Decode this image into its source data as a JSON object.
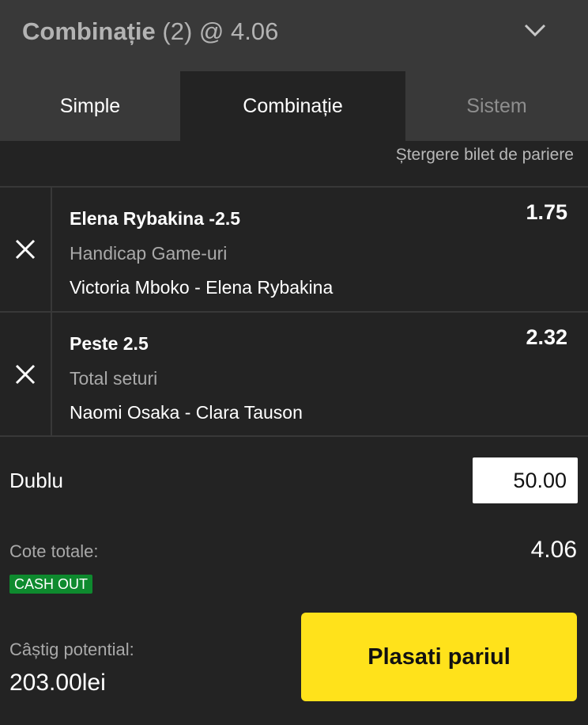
{
  "header": {
    "title_bold": "Combinație",
    "title_rest": " (2) @ 4.06"
  },
  "tabs": [
    {
      "label": "Simple",
      "active": false
    },
    {
      "label": "Combinație",
      "active": true
    },
    {
      "label": "Sistem",
      "active": false
    }
  ],
  "clear_label": "Ștergere bilet de pariere",
  "selections": [
    {
      "name": "Elena Rybakina -2.5",
      "market": "Handicap Game-uri",
      "event": "Victoria Mboko - Elena Rybakina",
      "odds": "1.75"
    },
    {
      "name": "Peste 2.5",
      "market": "Total seturi",
      "event": "Naomi Osaka - Clara Tauson",
      "odds": "2.32"
    }
  ],
  "bet": {
    "type_label": "Dublu",
    "stake": "50.00"
  },
  "summary": {
    "total_odds_label": "Cote totale:",
    "total_odds": "4.06",
    "cashout_badge": "CASH OUT",
    "potential_win_label": "Câștig potential:",
    "potential_win": "203.00lei"
  },
  "place_button": "Plasati pariul",
  "colors": {
    "accent_yellow": "#ffe21b",
    "cashout_green": "#0e8a2e",
    "background": "#232323",
    "header": "#393939"
  },
  "icons": {
    "collapse": "chevron-down-icon",
    "remove": "close-icon"
  }
}
